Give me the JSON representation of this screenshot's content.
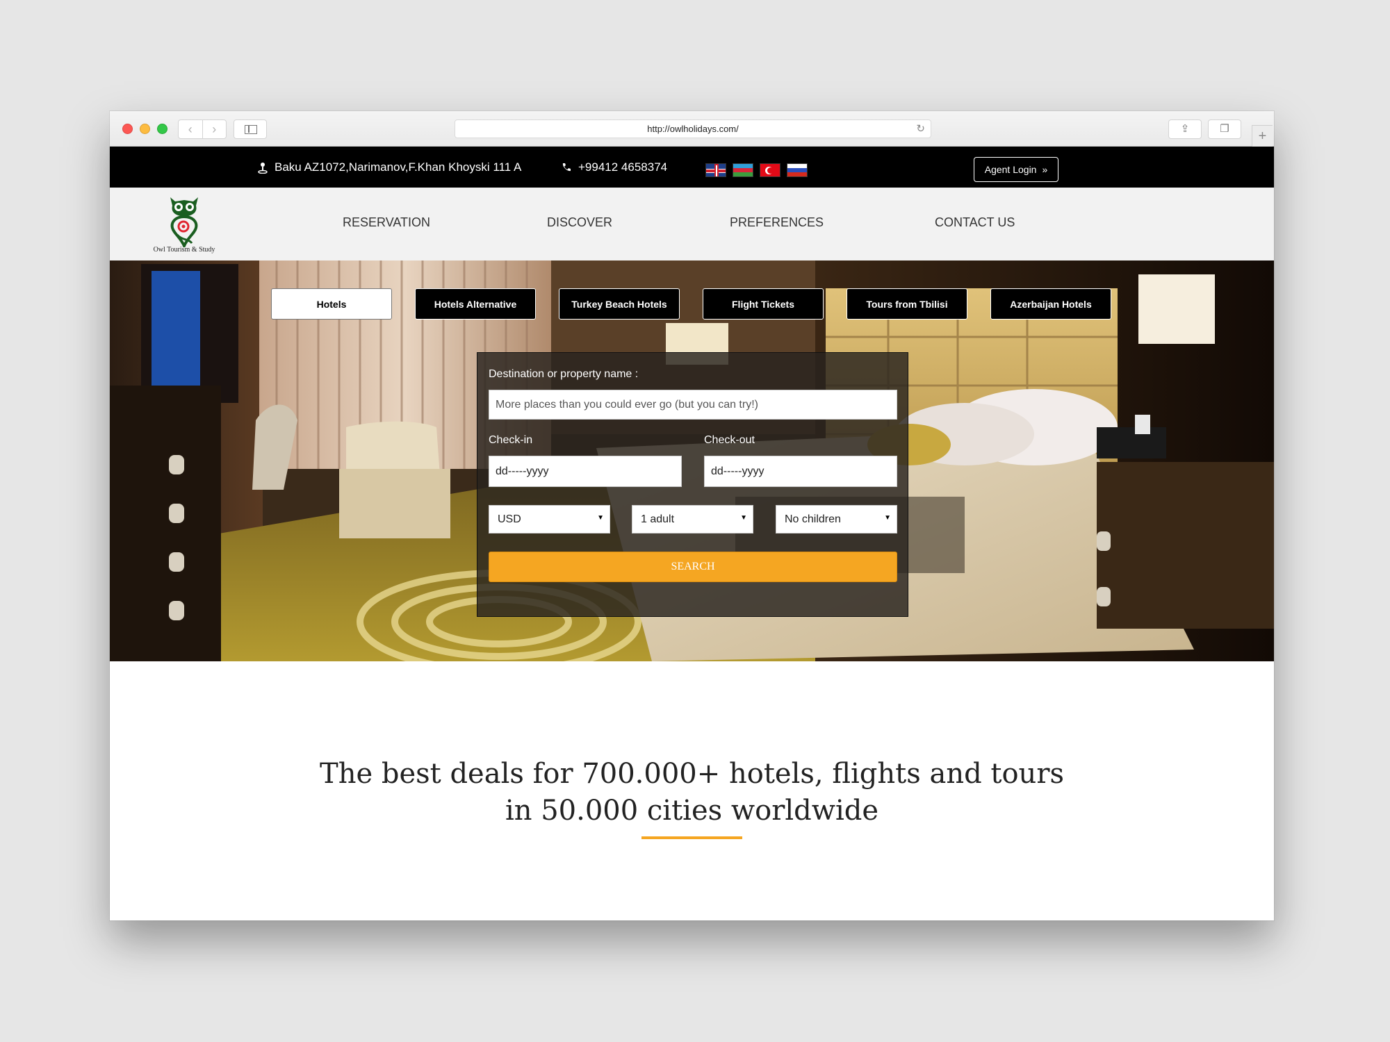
{
  "browser": {
    "url": "http://owlholidays.com/"
  },
  "topbar": {
    "address": "Baku AZ1072,Narimanov,F.Khan Khoyski 111 A",
    "phone": "+99412 4658374",
    "flags": [
      "uk-flag",
      "azerbaijan-flag",
      "turkey-flag",
      "russia-flag"
    ],
    "agent_login": "Agent Login"
  },
  "logo": {
    "text": "Owl Tourism & Study"
  },
  "nav": {
    "items": [
      "RESERVATION",
      "DISCOVER",
      "PREFERENCES",
      "CONTACT US"
    ]
  },
  "tabs": {
    "items": [
      "Hotels",
      "Hotels Alternative",
      "Turkey Beach Hotels",
      "Flight Tickets",
      "Tours from Tbilisi",
      "Azerbaijan Hotels"
    ],
    "active": "Hotels"
  },
  "search": {
    "destination_label": "Destination or property name :",
    "destination_placeholder": "More places than you could ever go (but you can try!)",
    "checkin_label": "Check-in",
    "checkout_label": "Check-out",
    "checkin_value": "dd-----yyyy",
    "checkout_value": "dd-----yyyy",
    "currency": "USD",
    "adults": "1 adult",
    "children": "No children",
    "button": "SEARCH"
  },
  "tagline": "The best deals for 700.000+ hotels, flights and tours in 50.000 cities worldwide",
  "colors": {
    "accent": "#f5a622",
    "topbar": "#000000",
    "navbar": "#f2f2f2"
  }
}
